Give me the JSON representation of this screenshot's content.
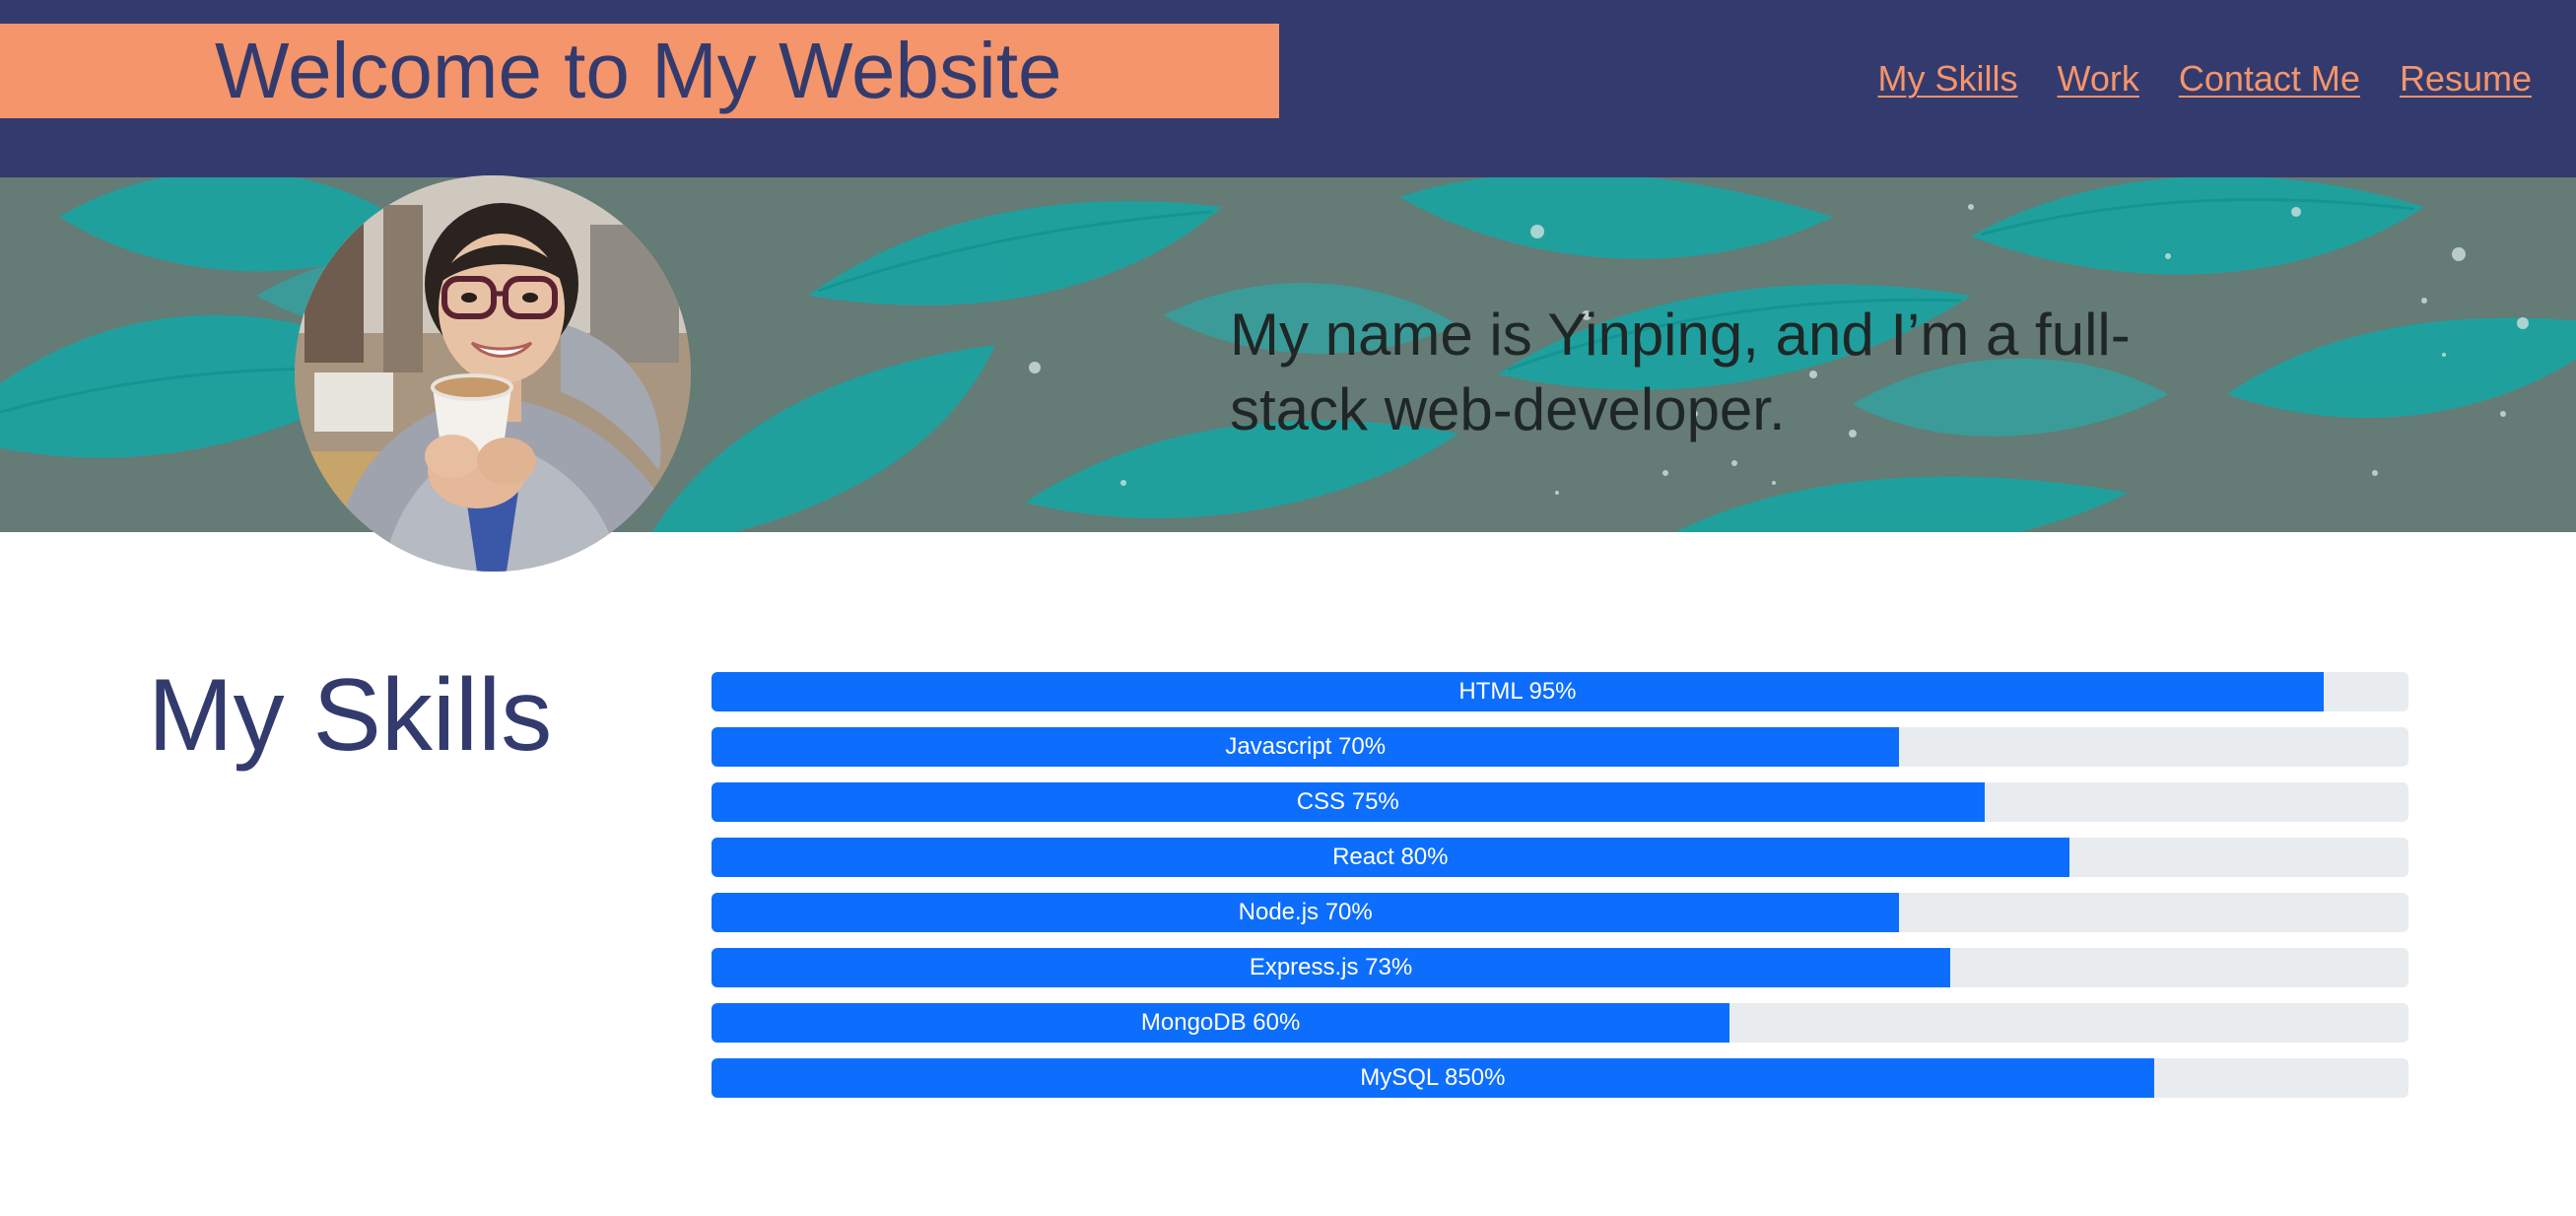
{
  "header": {
    "title": "Welcome to My Website",
    "nav": [
      {
        "label": "My Skills"
      },
      {
        "label": "Work"
      },
      {
        "label": "Contact Me"
      },
      {
        "label": "Resume"
      }
    ]
  },
  "hero": {
    "tagline": "My name is Yinping, and I’m a full-stack web-developer."
  },
  "skills": {
    "heading": "My Skills",
    "items": [
      {
        "label": "HTML 95%",
        "fill_percent": 95
      },
      {
        "label": "Javascript 70%",
        "fill_percent": 70
      },
      {
        "label": "CSS 75%",
        "fill_percent": 75
      },
      {
        "label": "React 80%",
        "fill_percent": 80
      },
      {
        "label": "Node.js 70%",
        "fill_percent": 70
      },
      {
        "label": "Express.js 73%",
        "fill_percent": 73
      },
      {
        "label": "MongoDB 60%",
        "fill_percent": 60
      },
      {
        "label": "MySQL 850%",
        "fill_percent": 85
      }
    ]
  },
  "colors": {
    "header_bg": "#333b6e",
    "accent": "#f4956b",
    "progress_fill": "#0d6efd",
    "progress_track": "#e9ecef",
    "hero_teal": "#14a7a5"
  }
}
